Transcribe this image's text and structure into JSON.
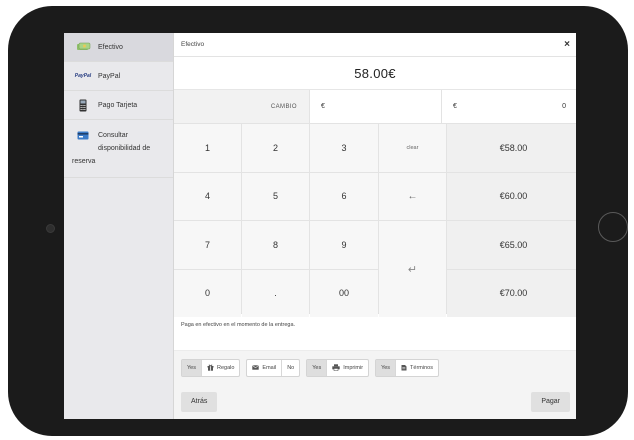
{
  "sidebar": {
    "items": [
      {
        "label": "Efectivo",
        "icon": "cash-icon"
      },
      {
        "label": "PayPal",
        "icon": "paypal-logo",
        "logo_text": "PayPal"
      },
      {
        "label": "Pago Tarjeta",
        "icon": "card-terminal-icon"
      },
      {
        "line1": "Consultar",
        "line2": "disponibilidad de",
        "line3": "reserva",
        "icon": "credit-card-icon"
      }
    ]
  },
  "header": {
    "title": "Efectivo",
    "close": "×"
  },
  "total": "58.00€",
  "change": {
    "label": "CAMBIO",
    "input_currency": "€",
    "value_currency": "€",
    "value": "0"
  },
  "keypad": {
    "keys": [
      "1",
      "2",
      "3",
      "clear",
      "4",
      "5",
      "6",
      "←",
      "7",
      "8",
      "9",
      "0",
      ".",
      "00"
    ],
    "enter": "↵",
    "amounts": [
      "€58.00",
      "€60.00",
      "€65.00",
      "€70.00"
    ]
  },
  "note": "Paga en efectivo en el momento de la entrega.",
  "toggles": {
    "gift": {
      "on": "Yes",
      "label": "Regalo"
    },
    "email": {
      "label": "Email",
      "off": "No"
    },
    "print": {
      "on": "Yes",
      "label": "Imprimir"
    },
    "terms": {
      "on": "Yes",
      "label": "Términos"
    }
  },
  "footer": {
    "back": "Atrás",
    "pay": "Pagar"
  },
  "colors": {
    "device": "#1b1b1b",
    "sidebar": "#e9e9ec",
    "paypal_blue": "#253b80",
    "paypal_light": "#179bd7"
  }
}
